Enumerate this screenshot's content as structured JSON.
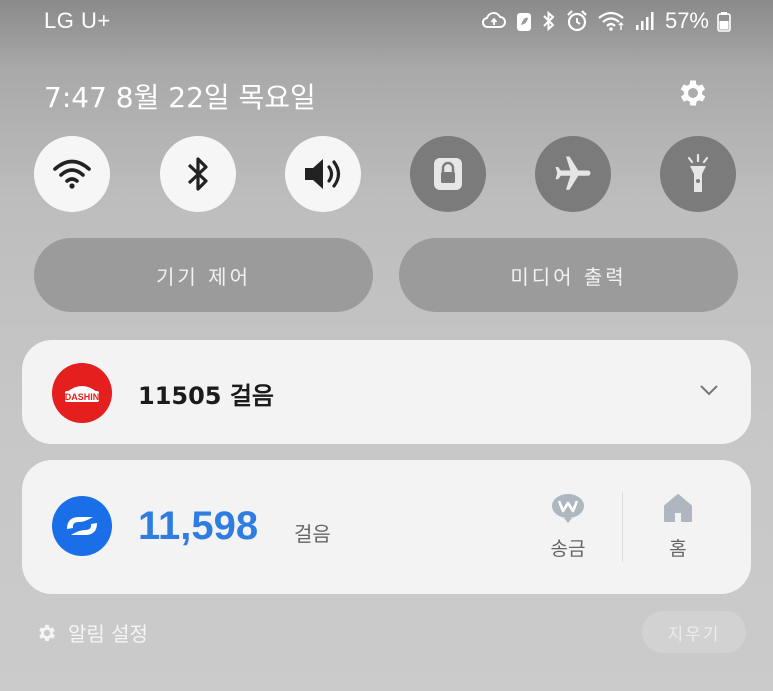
{
  "status_bar": {
    "carrier": "LG U+",
    "battery_percent": "57%",
    "icons": [
      "cloud-sync-icon",
      "battery-saver-icon",
      "bluetooth-icon",
      "alarm-icon",
      "wifi-icon",
      "signal-icon",
      "battery-icon"
    ]
  },
  "header": {
    "datetime": "7:47 8월 22일 목요일",
    "settings_icon": "gear-icon"
  },
  "quick_settings": [
    {
      "name": "wifi",
      "icon": "wifi-icon",
      "state": "on"
    },
    {
      "name": "bluetooth",
      "icon": "bluetooth-icon",
      "state": "on"
    },
    {
      "name": "sound",
      "icon": "volume-icon",
      "state": "on"
    },
    {
      "name": "rotation-lock",
      "icon": "lock-icon",
      "state": "off"
    },
    {
      "name": "airplane-mode",
      "icon": "airplane-icon",
      "state": "off"
    },
    {
      "name": "flashlight",
      "icon": "flashlight-icon",
      "state": "off"
    }
  ],
  "pills": {
    "device_control": "기기 제어",
    "media_output": "미디어 출력"
  },
  "notifications": {
    "card1": {
      "logo_text": "DASHIN",
      "text": "11505 걸음"
    },
    "card2": {
      "steps": "11,598",
      "unit": "걸음",
      "actions": [
        {
          "label": "송금",
          "icon": "won-transfer-icon"
        },
        {
          "label": "홈",
          "icon": "home-icon"
        }
      ]
    }
  },
  "footer": {
    "notification_settings": "알림 설정",
    "clear": "지우기"
  },
  "colors": {
    "accent_blue": "#2f7de1",
    "logo_red": "#e51e1e",
    "logo_blue": "#1a6ee8"
  }
}
